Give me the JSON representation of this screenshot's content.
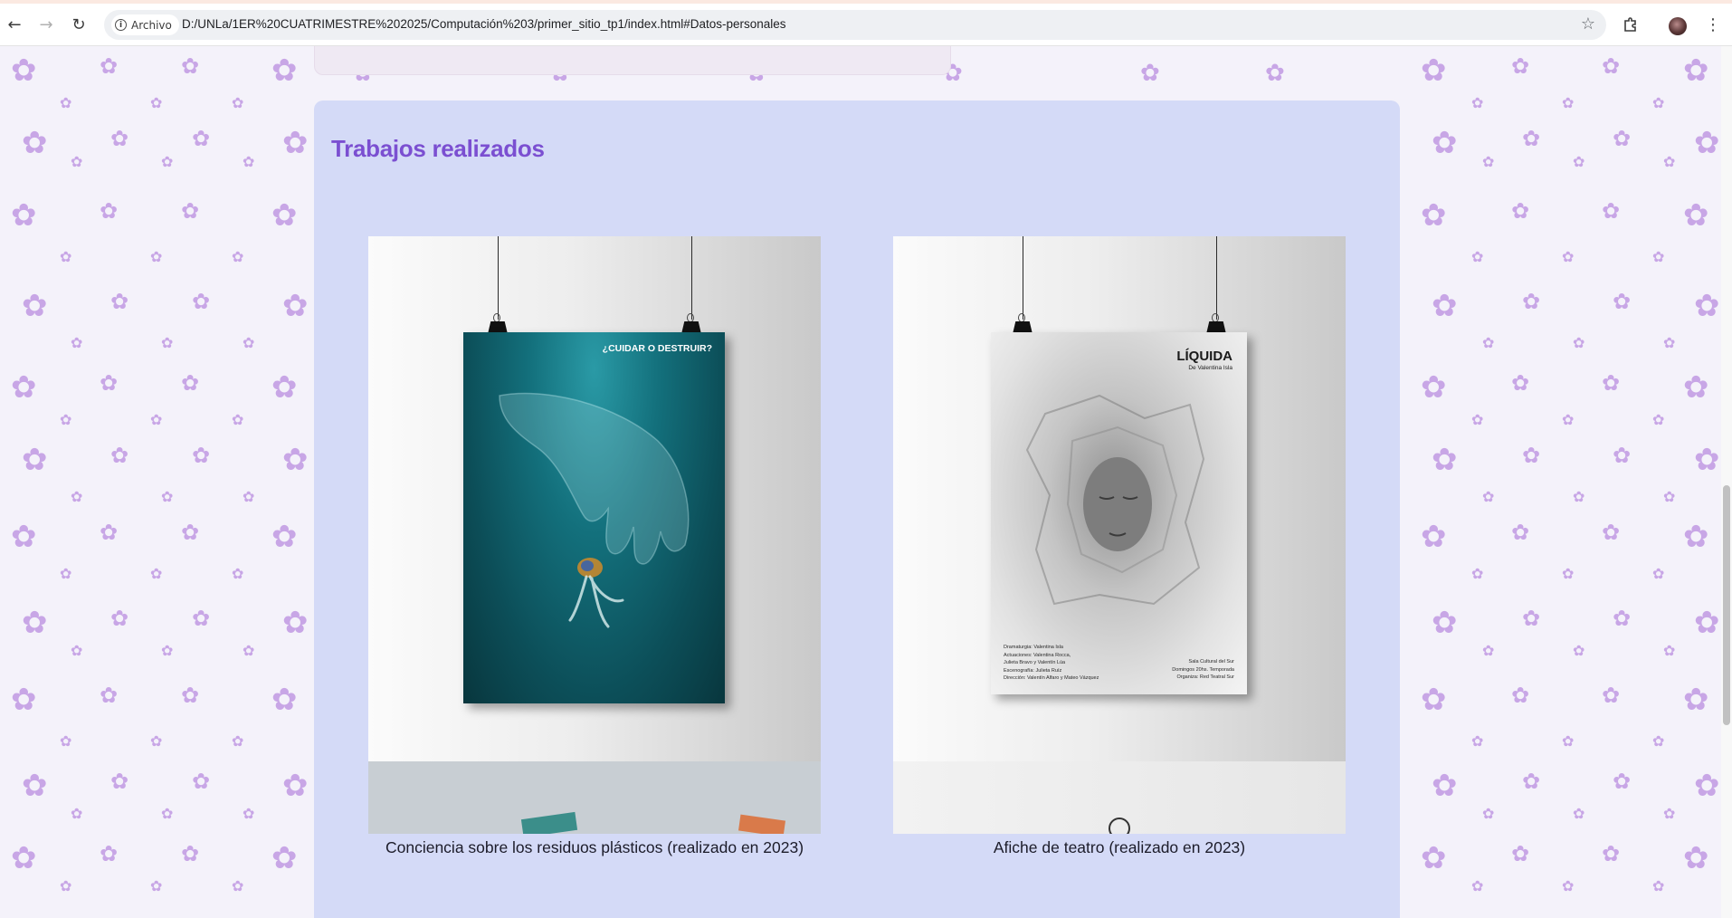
{
  "browser": {
    "back_icon": "back-arrow-icon",
    "forward_icon": "forward-arrow-icon",
    "reload_icon": "reload-icon",
    "site_chip_label": "Archivo",
    "url": "D:/UNLa/1ER%20CUATRIMESTRE%202025/Computación%203/primer_sitio_tp1/index.html#Datos-personales",
    "bookmark_icon": "star-icon",
    "extensions_icon": "puzzle-icon",
    "menu_icon": "kebab-menu-icon"
  },
  "colors": {
    "section_bg": "#d4daf7",
    "title": "#7b4fd1",
    "flower": "#c8a6e6",
    "page_bg": "#f4f2fa"
  },
  "section": {
    "title": "Trabajos realizados",
    "works": [
      {
        "caption": "Conciencia sobre los residuos plásticos (realizado en 2023)",
        "poster_headline": "¿CUIDAR O DESTRUIR?"
      },
      {
        "caption": "Afiche de teatro (realizado en 2023)",
        "poster_title": "LÍQUIDA",
        "poster_subtitle": "De Valentina Isla",
        "credits_left": [
          "Dramaturgia: Valentina Isla",
          "Actuaciones: Valentina Rocca,",
          "Julieta Bravo y Valentín Lúa",
          "Escenografía: Julieta Ruíz",
          "Dirección: Valentín Alfaro y Mateo Vázquez"
        ],
        "credits_right": [
          "Sala Cultural del Sur",
          "Domingos 20hs. Temporada",
          "Organiza: Red Teatral Sur"
        ]
      }
    ]
  }
}
